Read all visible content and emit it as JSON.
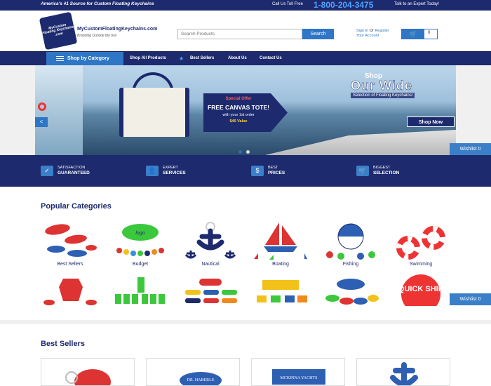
{
  "topbar": {
    "tagline": "America's #1 Source for Custom Floating Keychains",
    "call_prefix": "Call Us Toll Free",
    "phone": "1-800-204-3475",
    "call_suffix": "Talk to an Expert Today!"
  },
  "header": {
    "logo_badge": "MyCustom Floating Keychains .com",
    "logo_text": "MyCustomFloatingKeychains.com",
    "logo_sub": "Branding Outside the box",
    "search_placeholder": "Search Products",
    "search_button": "Search",
    "sign_in": "Sign In",
    "or": "Or",
    "register": "Register",
    "account": "Your Account",
    "cart_count": "0"
  },
  "nav": {
    "shop_by_category": "Shop by Category",
    "links": [
      "Shop All Products",
      "Best Sellers",
      "About Us",
      "Contact Us"
    ]
  },
  "banner": {
    "special_offer": "Special Offer",
    "free_tote": "FREE CANVAS TOTE!",
    "with_order": "with your 1st order",
    "value": "$40 Value",
    "shop": "Shop",
    "our_wide": "Our Wide",
    "selection": "Selection of Floating Keychains!",
    "shop_now": "Shop Now",
    "prev": "<"
  },
  "wishlist": "Wishlist 0",
  "features": [
    {
      "icon": "$",
      "line1": "SATISFACTION",
      "line2": "GUARANTEED",
      "icon_name": "check-icon"
    },
    {
      "icon": "☺",
      "line1": "EXPERT",
      "line2": "SERVICES",
      "icon_name": "person-icon"
    },
    {
      "icon": "$",
      "line1": "BEST",
      "line2": "PRICES",
      "icon_name": "dollar-icon"
    },
    {
      "icon": "🛒",
      "line1": "BIGGEST",
      "line2": "SELECTION",
      "icon_name": "cart-icon"
    }
  ],
  "popular": {
    "title": "Popular Categories",
    "categories": [
      "Best Sellers",
      "Budget",
      "Nautical",
      "Boating",
      "Fishing",
      "Swimming"
    ],
    "quick_ship": "QUICK SHIP"
  },
  "best_sellers": {
    "title": "Best Sellers",
    "product_1_text": "DR. HABERLE",
    "product_2_text": "MCKINNA YACHTS"
  },
  "colors": {
    "navy": "#1d2a6e",
    "accent_blue": "#2f76c6",
    "wishlist_blue": "#3c7fc9"
  }
}
